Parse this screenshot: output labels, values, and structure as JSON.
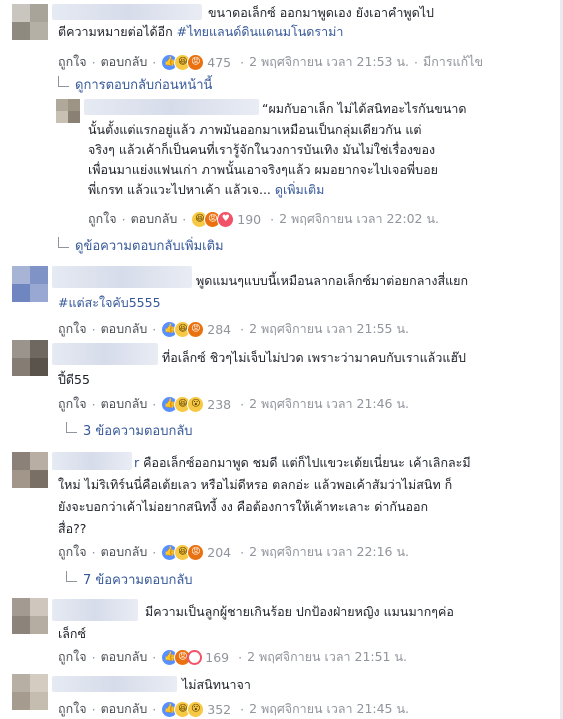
{
  "comments": [
    {
      "lines": [
        "ขนาดอเล็กซ์ ออกมาพูดเอง ยังเอาคำพูดไป",
        "ตีความหมายต่อได้อีก "
      ],
      "hashtag": "#ไทยแลนด์ดินแดนมโนดราม่า",
      "like": "ถูกใจ",
      "reply": "ตอบกลับ",
      "reactions": [
        "like",
        "haha",
        "angry"
      ],
      "count": "475",
      "time": "2 พฤศจิกายน เวลา 21:53 น.",
      "extra": "มีการแก้ไข"
    },
    {
      "lines": [
        "พูดแมนๆแบบนี้เหมือนลากอเล็กซ์มาต่อยกลางสี่แยก"
      ],
      "hashtag": "#แต่สะใจคับ5555",
      "like": "ถูกใจ",
      "reply": "ตอบกลับ",
      "reactions": [
        "like",
        "haha",
        "angry"
      ],
      "count": "284",
      "time": "2 พฤศจิกายน เวลา 21:55 น."
    },
    {
      "lines": [
        "ที่อเล็กซ์ ชิวๆไม่เจ็บไม่ปวด เพราะว่ามาคบกับเราแล้วแฮ๊ป",
        "ปี้ดี55"
      ],
      "like": "ถูกใจ",
      "reply": "ตอบกลับ",
      "reactions": [
        "like",
        "haha",
        "wow"
      ],
      "count": "238",
      "time": "2 พฤศจิกายน เวลา 21:46 น."
    },
    {
      "name_tail": "r",
      "lines": [
        "คืออเล็กซ์ออกมาพูด ชมดี แต่ก็ไปแขวะเต้ยเนี่ยนะ เค้าเลิกละมี",
        "ใหม่ ไม่ริเทิร์นนี่คือเต้ยเลว หรือไม่ดีหรอ ตลกอ่ะ แล้วพอเค้าสัมว่าไม่สนิท ก็",
        "ยังจะบอกว่าเค้าไม่อยากสนิทงี้ งง คือต้องการให้เค้าทะเลาะ ด่ากันออก",
        "สื่อ??"
      ],
      "like": "ถูกใจ",
      "reply": "ตอบกลับ",
      "reactions": [
        "like",
        "haha",
        "angry"
      ],
      "count": "204",
      "time": "2 พฤศจิกายน เวลา 22:16 น."
    },
    {
      "lines": [
        "มีความเป็นลูกผู้ชายเกินร้อย ปกป้องฝ่ายหญิง แมนมากๆค่อ",
        "เล็กซ์"
      ],
      "like": "ถูกใจ",
      "reply": "ตอบกลับ",
      "reactions": [
        "like",
        "angry",
        "ring"
      ],
      "count": "169",
      "time": "2 พฤศจิกายน เวลา 21:51 น."
    },
    {
      "lines": [
        "ไม่สนิทนาจา"
      ],
      "like": "ถูกใจ",
      "reply": "ตอบกลับ",
      "reactions": [
        "like",
        "haha",
        "wow"
      ],
      "count": "352",
      "time": "2 พฤศจิกายน เวลา 21:45 น."
    }
  ],
  "reply": {
    "lines": [
      "“ผมกับอาเล็ก ไม่ได้สนิทอะไรกันขนาด",
      "นั้นตั้งแต่แรกอยู่แล้ว ภาพมันออกมาเหมือนเป็นกลุ่มเดียวกัน แต่",
      "จริงๆ แล้วเค้าก็เป็นคนที่เรารู้จักในวงการบันเทิง มันไม่ใช่เรื่องของ",
      "เพื่อนมาแย่งแฟนเก่า ภาพนั้นเอาจริงๆแล้ว ผมอยากจะไปเจอพี่บอย",
      "พี่เกรท แล้วแวะไปหาเค้า แล้วเจ... "
    ],
    "see_more": "ดูเพิ่มเติม",
    "like": "ถูกใจ",
    "reply": "ตอบกลับ",
    "reactions": [
      "haha",
      "angry",
      "love"
    ],
    "count": "190",
    "time": "2 พฤศจิกายน เวลา 22:02 น."
  },
  "links": {
    "prev_replies": "ดูการตอบกลับก่อนหน้านี้",
    "more_replies": "ดูข้อความตอบกลับเพิ่มเติม",
    "replies_3": "3 ข้อความตอบกลับ",
    "replies_7": "7 ข้อความตอบกลับ"
  },
  "dot": "·"
}
